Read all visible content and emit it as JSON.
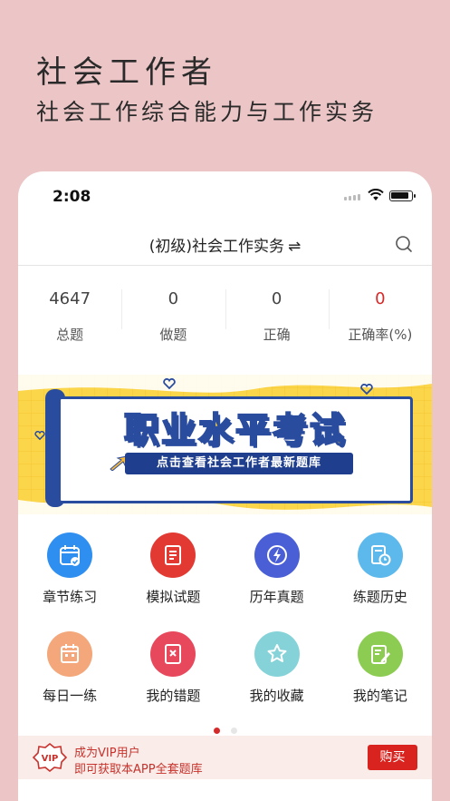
{
  "promo": {
    "title": "社会工作者",
    "subtitle": "社会工作综合能力与工作实务"
  },
  "status_bar": {
    "time": "2:08"
  },
  "nav": {
    "title": "(初级)社会工作实务",
    "swap_symbol": "⇌"
  },
  "stats": [
    {
      "value": "4647",
      "label": "总题"
    },
    {
      "value": "0",
      "label": "做题"
    },
    {
      "value": "0",
      "label": "正确"
    },
    {
      "value": "0",
      "label": "正确率(%)"
    }
  ],
  "banner": {
    "title": "职业水平考试",
    "subtitle": "点击查看社会工作者最新题库"
  },
  "features": [
    {
      "label": "章节练习",
      "icon": "calendar-check-icon",
      "color": "#2f8ff0"
    },
    {
      "label": "模拟试题",
      "icon": "document-list-icon",
      "color": "#e23a32"
    },
    {
      "label": "历年真题",
      "icon": "lightning-icon",
      "color": "#4a5fd6"
    },
    {
      "label": "练题历史",
      "icon": "history-clock-icon",
      "color": "#5db8ec"
    },
    {
      "label": "每日一练",
      "icon": "daily-calendar-icon",
      "color": "#f3a77a"
    },
    {
      "label": "我的错题",
      "icon": "wrong-notebook-icon",
      "color": "#e8485c"
    },
    {
      "label": "我的收藏",
      "icon": "star-icon",
      "color": "#85d3d8"
    },
    {
      "label": "我的笔记",
      "icon": "note-pen-icon",
      "color": "#8ccc52"
    }
  ],
  "vip": {
    "badge": "VIP",
    "line1": "成为VIP用户",
    "line2": "即可获取本APP全套题库",
    "button": "购买"
  },
  "colors": {
    "accent": "#d42a2a",
    "background": "#ecc6c6",
    "banner": "#fbd64a"
  }
}
